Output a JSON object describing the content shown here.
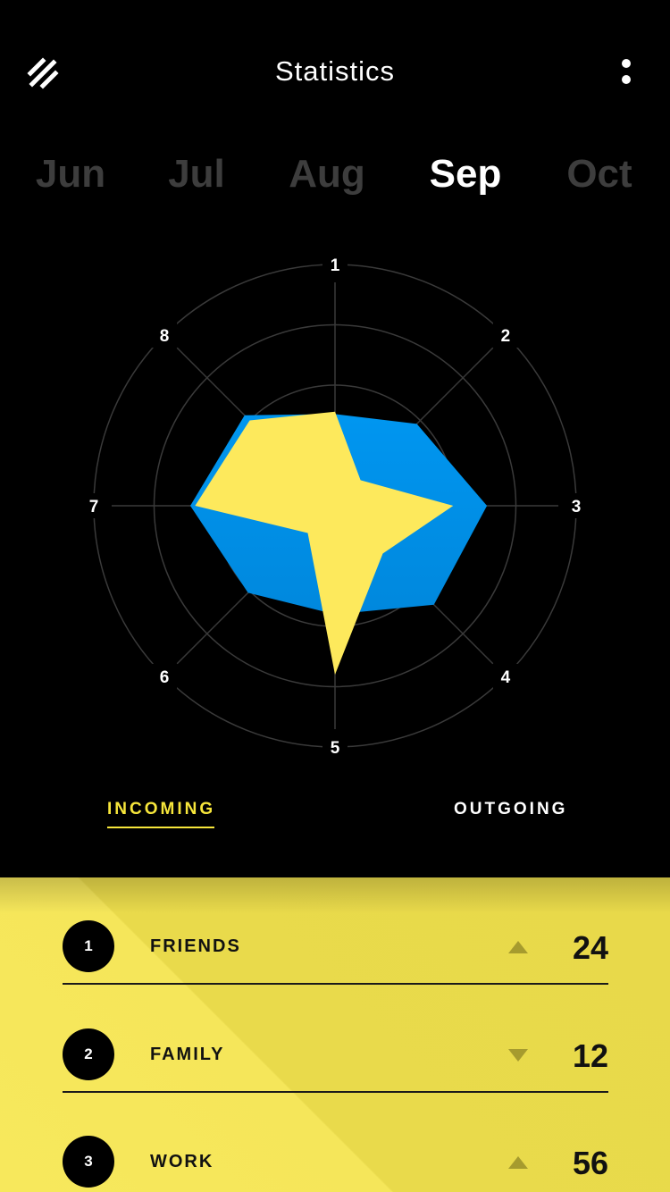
{
  "header": {
    "title": "Statistics",
    "logo_icon": "double-slash-icon",
    "menu_icon": "vertical-dots-icon"
  },
  "months": [
    "Jun",
    "Jul",
    "Aug",
    "Sep",
    "Oct"
  ],
  "selected_month": "Sep",
  "chart_data": {
    "type": "radar",
    "axes": [
      "1",
      "2",
      "3",
      "4",
      "5",
      "6",
      "7",
      "8"
    ],
    "rings": 4,
    "series": [
      {
        "color": "#0096f0",
        "values": [
          0.38,
          0.48,
          0.63,
          0.58,
          0.45,
          0.51,
          0.6,
          0.53
        ]
      },
      {
        "color": "#fde95c",
        "values": [
          0.39,
          0.15,
          0.49,
          0.28,
          0.7,
          0.16,
          0.58,
          0.5
        ]
      }
    ]
  },
  "tabs": {
    "incoming": "INCOMING",
    "outgoing": "OUTGOING",
    "active": "incoming"
  },
  "list": [
    {
      "rank": "1",
      "label": "FRIENDS",
      "trend": "up",
      "value": "24"
    },
    {
      "rank": "2",
      "label": "FAMILY",
      "trend": "down",
      "value": "12"
    },
    {
      "rank": "3",
      "label": "WORK",
      "trend": "up",
      "value": "56"
    }
  ],
  "colors": {
    "accent_yellow": "#f7e63b",
    "chart_blue": "#0096f0",
    "panel_yellow": "#ede04f",
    "trend_arrow": "#a69b2e"
  }
}
